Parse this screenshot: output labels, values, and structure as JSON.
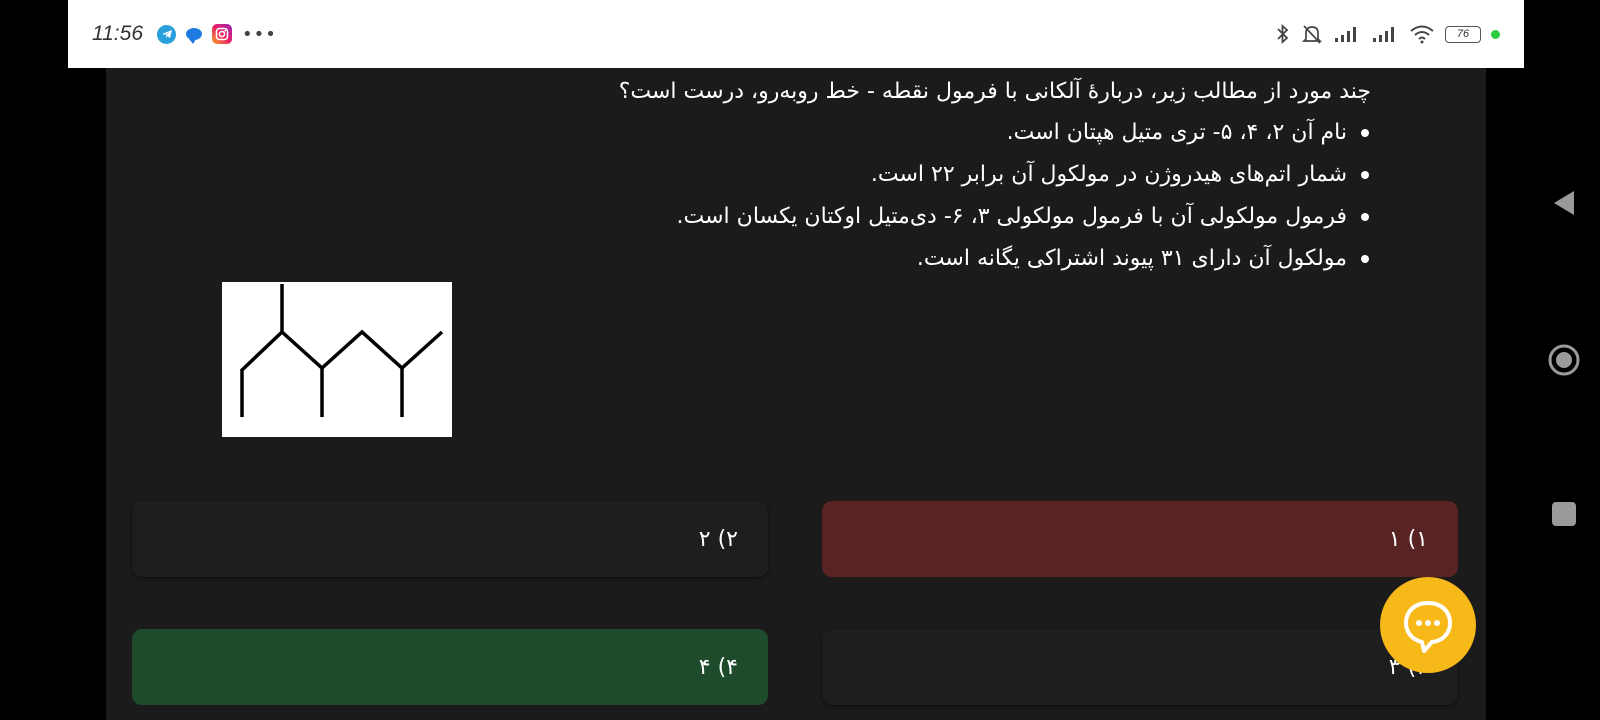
{
  "status_bar": {
    "time": "11:56",
    "battery_level": "76",
    "overflow": "•••",
    "icons": [
      "telegram-icon",
      "message-bubble-icon",
      "instagram-icon",
      "bluetooth-icon",
      "mute-bell-icon",
      "signal-icon",
      "signal-icon",
      "wifi-icon",
      "battery-icon"
    ]
  },
  "question": {
    "title": "چند مورد از مطالب زیر، دربارهٔ آلکانی با فرمول نقطه - خط روبه‌رو، درست است؟",
    "statements": [
      "نام آن ۲، ۴، ۵- تری متیل هپتان است.",
      "شمار اتم‌های هیدروژن در مولکول آن برابر ۲۲ است.",
      "فرمول مولکولی آن با فرمول مولکولی ۳، ۶- دی‌متیل اوکتان یکسان است.",
      "مولکول آن دارای ۳۱ پیوند اشتراکی یگانه است."
    ]
  },
  "options": [
    {
      "label": "۱) ۱",
      "state": "wrong",
      "color": "#5a2323"
    },
    {
      "label": "۲) ۲",
      "state": "neutral",
      "color": "#1e1e1e"
    },
    {
      "label": "۳) ۳",
      "state": "neutral",
      "color": "#1e1e1e"
    },
    {
      "label": "۴) ۴",
      "state": "correct",
      "color": "#1d4b2c"
    }
  ],
  "colors": {
    "accent_fab": "#f7b81a",
    "background": "#1b1b1b"
  },
  "nav": [
    "back-icon",
    "home-icon",
    "recents-icon"
  ]
}
